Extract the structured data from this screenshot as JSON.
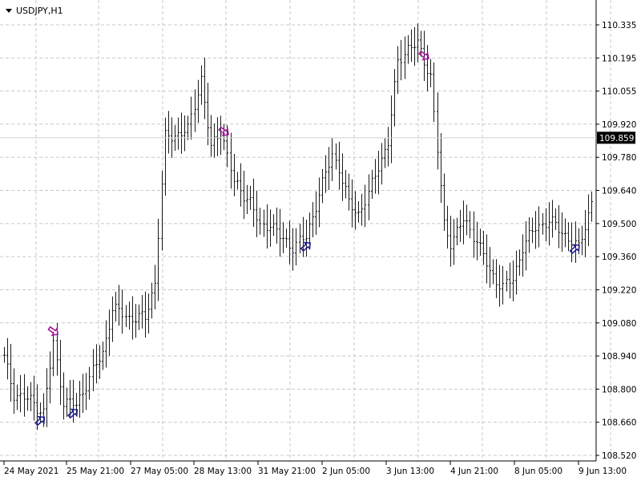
{
  "window": {
    "symbol_title": "USDJPY,H1",
    "menu_icon": "triangle-down-icon"
  },
  "current_price": {
    "label": "109.859",
    "value": 109.859
  },
  "colors": {
    "background": "#ffffff",
    "bars": "#1a1a1a",
    "grid": "#c8c8c8",
    "buy_arrow": "#1f1f8f",
    "sell_arrow": "#a21a9f",
    "price_tag_bg": "#000000",
    "price_tag_text": "#ffffff"
  },
  "chart_data": {
    "type": "bar",
    "title": "USDJPY,H1",
    "grid": true,
    "xlabel": "",
    "ylabel": "",
    "ylim": [
      108.52,
      110.39
    ],
    "y_ticks": [
      "110.335",
      "110.195",
      "110.055",
      "109.920",
      "109.780",
      "109.640",
      "109.500",
      "109.360",
      "109.220",
      "109.080",
      "108.940",
      "108.800",
      "108.660",
      "108.520"
    ],
    "x_ticks": [
      "24 May 2021",
      "25 May 21:00",
      "27 May 05:00",
      "28 May 13:00",
      "31 May 21:00",
      "2 Jun 05:00",
      "3 Jun 13:00",
      "4 Jun 21:00",
      "8 Jun 05:00",
      "9 Jun 13:00"
    ],
    "x_count": 180,
    "close_keypoints": [
      [
        0,
        108.93
      ],
      [
        3,
        108.78
      ],
      [
        8,
        108.75
      ],
      [
        12,
        108.7
      ],
      [
        15,
        108.99
      ],
      [
        18,
        108.75
      ],
      [
        22,
        108.73
      ],
      [
        26,
        108.85
      ],
      [
        30,
        108.95
      ],
      [
        33,
        109.14
      ],
      [
        38,
        109.1
      ],
      [
        43,
        109.1
      ],
      [
        46,
        109.25
      ],
      [
        49,
        109.86
      ],
      [
        52,
        109.87
      ],
      [
        56,
        109.89
      ],
      [
        60,
        110.11
      ],
      [
        63,
        109.81
      ],
      [
        66,
        109.9
      ],
      [
        70,
        109.67
      ],
      [
        75,
        109.59
      ],
      [
        78,
        109.48
      ],
      [
        81,
        109.5
      ],
      [
        84,
        109.44
      ],
      [
        88,
        109.4
      ],
      [
        92,
        109.44
      ],
      [
        96,
        109.62
      ],
      [
        100,
        109.79
      ],
      [
        102,
        109.73
      ],
      [
        105,
        109.58
      ],
      [
        108,
        109.54
      ],
      [
        111,
        109.62
      ],
      [
        114,
        109.74
      ],
      [
        117,
        109.84
      ],
      [
        120,
        110.18
      ],
      [
        123,
        110.24
      ],
      [
        126,
        110.25
      ],
      [
        130,
        110.12
      ],
      [
        134,
        109.49
      ],
      [
        136,
        109.42
      ],
      [
        140,
        109.51
      ],
      [
        144,
        109.43
      ],
      [
        148,
        109.29
      ],
      [
        152,
        109.23
      ],
      [
        155,
        109.26
      ],
      [
        158,
        109.4
      ],
      [
        162,
        109.48
      ],
      [
        166,
        109.51
      ],
      [
        171,
        109.45
      ],
      [
        175,
        109.39
      ],
      [
        179,
        109.59
      ]
    ],
    "buy_arrow_bars": [
      11,
      21,
      92,
      174
    ],
    "sell_arrow_bars": [
      15,
      67,
      128
    ]
  }
}
